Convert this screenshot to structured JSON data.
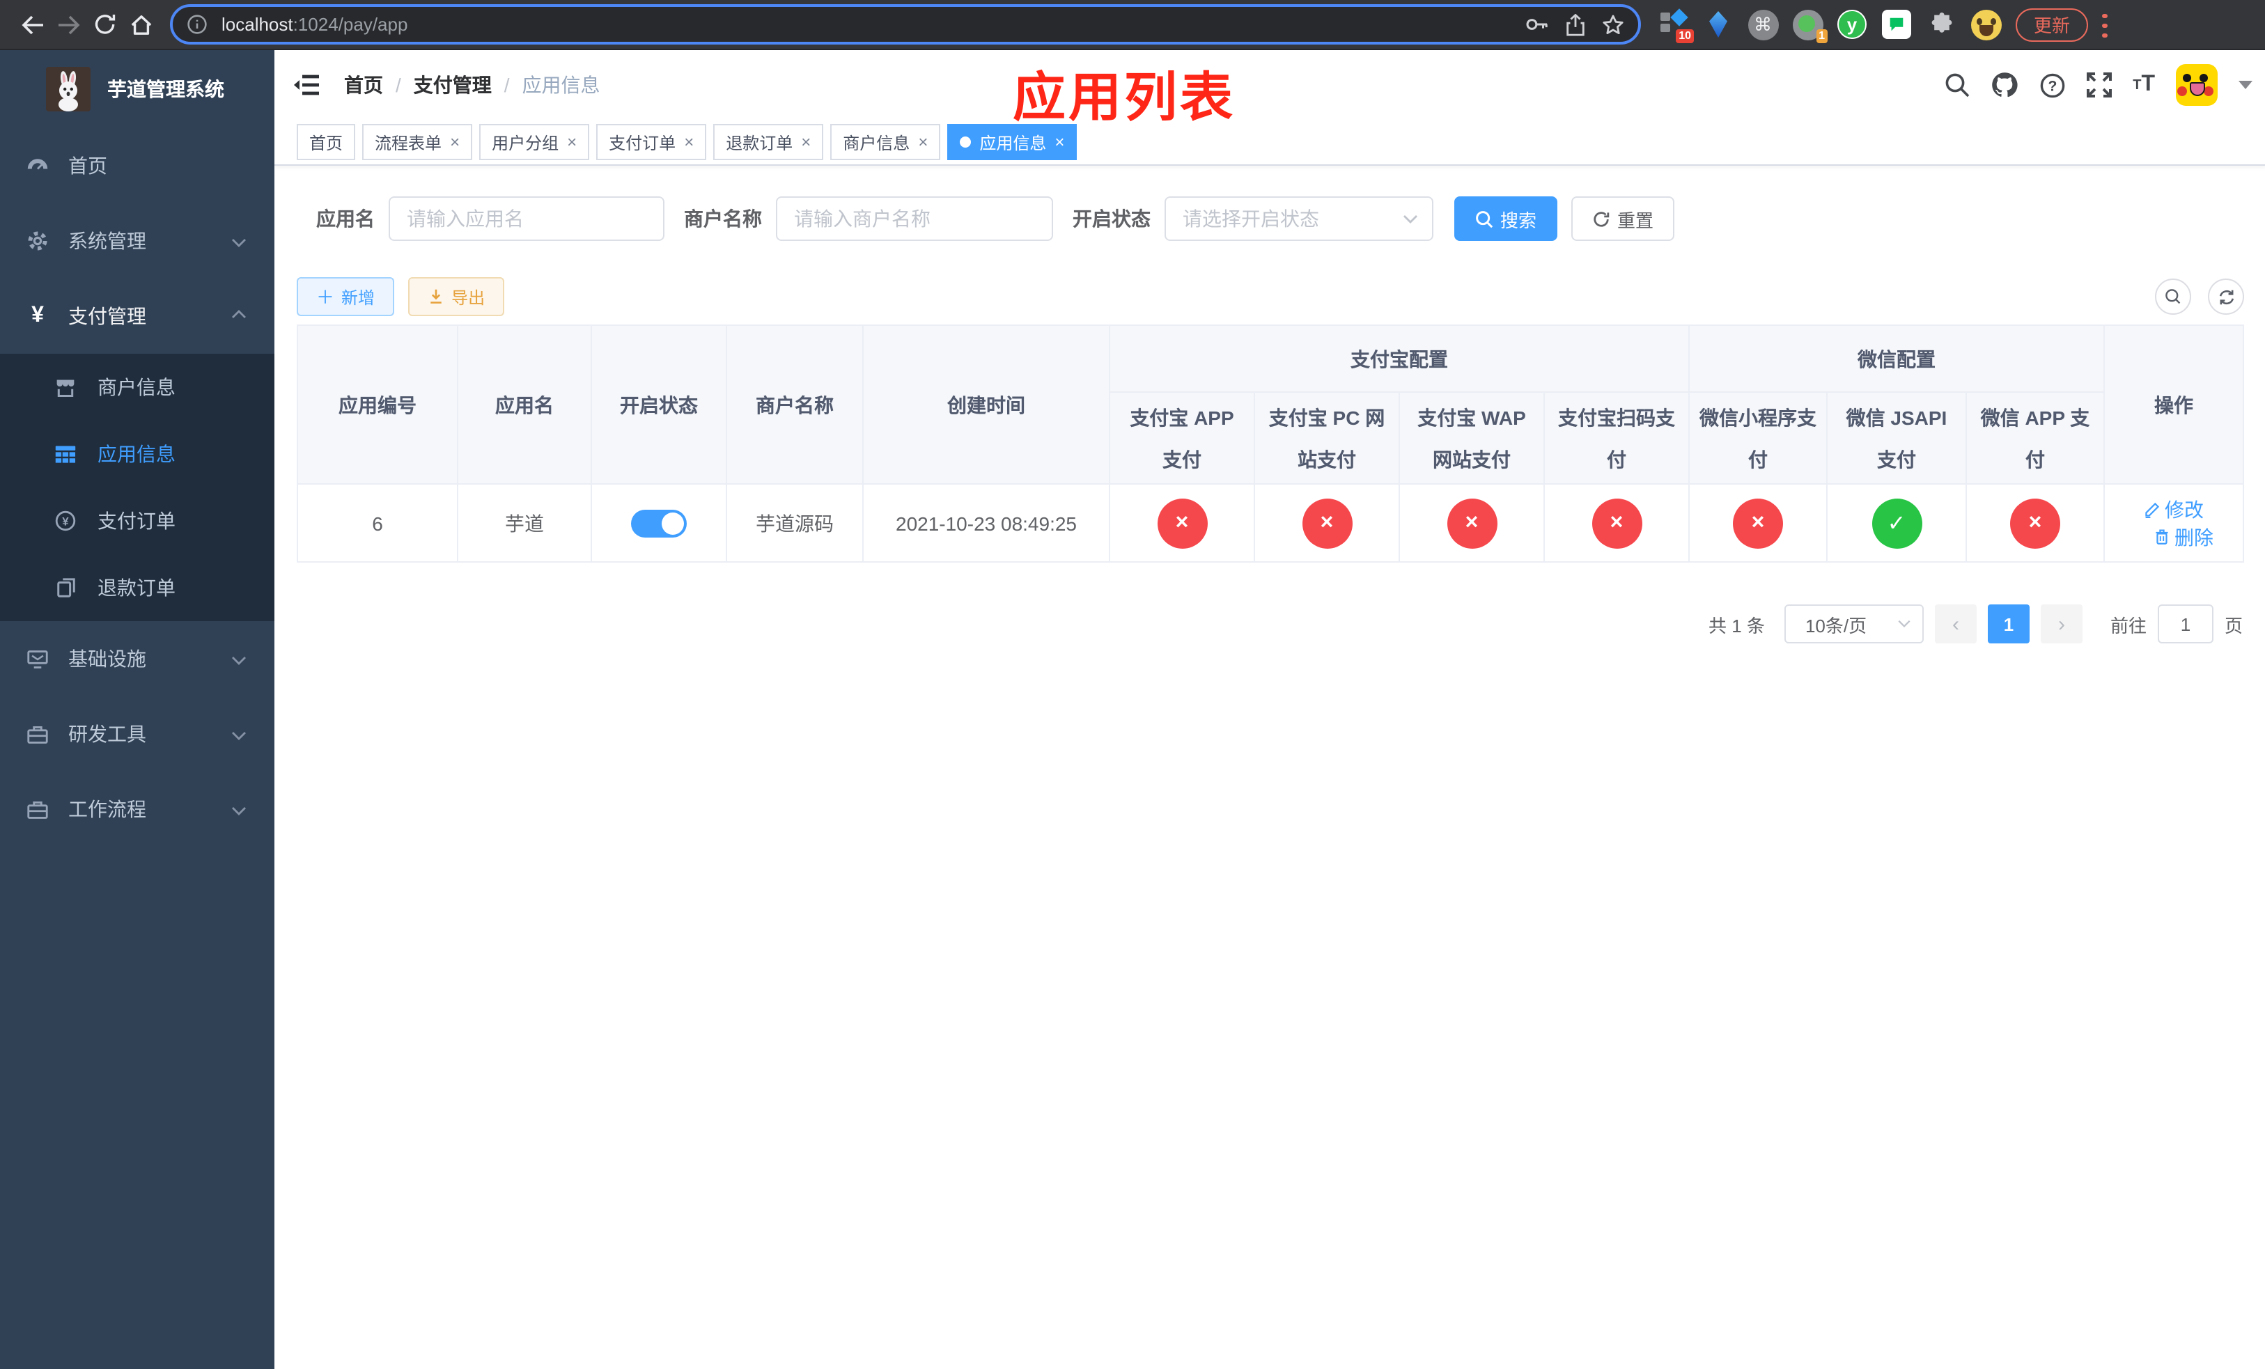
{
  "colors": {
    "accent": "#409eff",
    "success": "#28c445",
    "danger": "#f5484d",
    "warning": "#e6a23c",
    "sidebar_bg": "#304156",
    "submenu_bg": "#1f2d3d",
    "annotation_red": "#fe2616"
  },
  "browser": {
    "url": {
      "host": "localhost",
      "rest": ":1024/pay/app"
    },
    "extension_badge_10": "10",
    "extension_badge_1": "1",
    "extension_y_label": "y",
    "cmd_glyph": "⌘",
    "update_label": "更新"
  },
  "sidebar": {
    "logo_title": "芋道管理系统",
    "items": [
      {
        "label": "首页"
      },
      {
        "label": "系统管理"
      },
      {
        "label": "支付管理"
      },
      {
        "label": "商户信息"
      },
      {
        "label": "应用信息"
      },
      {
        "label": "支付订单"
      },
      {
        "label": "退款订单"
      },
      {
        "label": "基础设施"
      },
      {
        "label": "研发工具"
      },
      {
        "label": "工作流程"
      }
    ]
  },
  "navbar": {
    "breadcrumb": {
      "items": [
        "首页",
        "支付管理",
        "应用信息"
      ],
      "separator": "/"
    }
  },
  "annotation": {
    "text": "应用列表"
  },
  "tabs": [
    {
      "label": "首页",
      "closable": false,
      "active": false
    },
    {
      "label": "流程表单",
      "closable": true,
      "active": false
    },
    {
      "label": "用户分组",
      "closable": true,
      "active": false
    },
    {
      "label": "支付订单",
      "closable": true,
      "active": false
    },
    {
      "label": "退款订单",
      "closable": true,
      "active": false
    },
    {
      "label": "商户信息",
      "closable": true,
      "active": false
    },
    {
      "label": "应用信息",
      "closable": true,
      "active": true
    }
  ],
  "filters": {
    "app_name": {
      "label": "应用名",
      "placeholder": "请输入应用名"
    },
    "merchant_name": {
      "label": "商户名称",
      "placeholder": "请输入商户名称"
    },
    "status": {
      "label": "开启状态",
      "placeholder": "请选择开启状态"
    },
    "search_label": "搜索",
    "reset_label": "重置"
  },
  "toolbar": {
    "add_label": "新增",
    "export_label": "导出"
  },
  "table": {
    "columns": {
      "id": "应用编号",
      "name": "应用名",
      "status": "开启状态",
      "merchant": "商户名称",
      "created": "创建时间",
      "ops": "操作"
    },
    "groups": {
      "alipay": "支付宝配置",
      "wechat": "微信配置"
    },
    "pay_columns": [
      "支付宝 APP 支付",
      "支付宝 PC 网站支付",
      "支付宝 WAP 网站支付",
      "支付宝扫码支付",
      "微信小程序支付",
      "微信 JSAPI 支付",
      "微信 APP 支付"
    ],
    "row": {
      "id": "6",
      "name": "芋道",
      "status_on": true,
      "merchant": "芋道源码",
      "created": "2021-10-23 08:49:25",
      "statuses": [
        "disabled",
        "disabled",
        "disabled",
        "disabled",
        "disabled",
        "enabled",
        "disabled"
      ],
      "ops": {
        "edit": "修改",
        "delete": "删除"
      }
    },
    "glyphs": {
      "enabled": "✓",
      "disabled": "×"
    }
  },
  "pagination": {
    "total": "共 1 条",
    "page_size": "10条/页",
    "page": "1",
    "goto_prefix": "前往",
    "goto_value": "1",
    "goto_suffix": "页"
  }
}
